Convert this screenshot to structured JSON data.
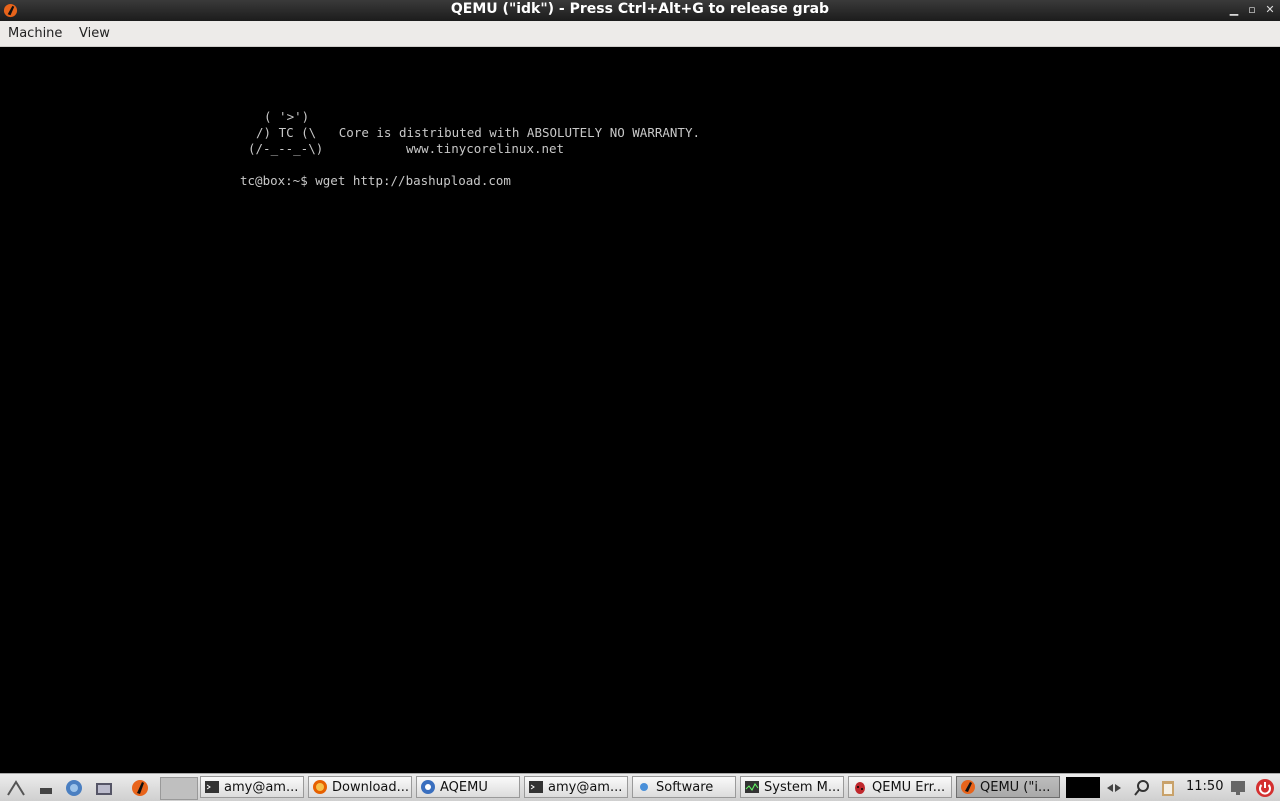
{
  "window": {
    "title": "QEMU (\"idk\") - Press Ctrl+Alt+G to release grab",
    "controls": [
      "minimize",
      "maximize",
      "close"
    ]
  },
  "menubar": {
    "items": [
      "Machine",
      "View"
    ]
  },
  "console": {
    "lines": [
      "( '>')",
      "/) TC (\\   Core is distributed with ABSOLUTELY NO WARRANTY.",
      "(/-_--_-\\)           www.tinycorelinux.net",
      "tc@box:~$ wget http://bashupload.com"
    ]
  },
  "taskbar": {
    "launchers": [
      "menu-icon",
      "show-desktop-icon",
      "network-icon",
      "file-manager-icon",
      "qemu-launcher-icon"
    ],
    "tasks": [
      {
        "label": "amy@am...",
        "icon": "terminal-icon",
        "active": false
      },
      {
        "label": "Download...",
        "icon": "firefox-icon",
        "active": false
      },
      {
        "label": "AQEMU",
        "icon": "aqemu-icon",
        "active": false
      },
      {
        "label": "amy@am...",
        "icon": "terminal-icon",
        "active": false
      },
      {
        "label": "Software",
        "icon": "software-icon",
        "active": false
      },
      {
        "label": "System M...",
        "icon": "system-monitor-icon",
        "active": false
      },
      {
        "label": "QEMU Err...",
        "icon": "bug-icon",
        "active": false
      },
      {
        "label": "QEMU (\"i...",
        "icon": "qemu-icon",
        "active": true
      }
    ],
    "clock": "11:50",
    "tray": [
      "search-icon",
      "clipboard-icon",
      "monitor-icon",
      "power-icon"
    ]
  }
}
